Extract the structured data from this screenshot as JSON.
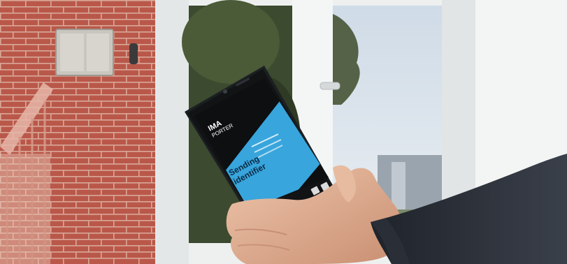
{
  "photo": {
    "phone_screen": {
      "brand_line1": "IMA",
      "brand_line2": "PORTER",
      "message_line1": "Sending",
      "message_line2": "identifier"
    }
  },
  "colors": {
    "brick": "#b9584a",
    "door_frame": "#eef0f0",
    "sky": "#d9e4ef",
    "foliage": "#3c4a2f",
    "phone_body": "#1c1f22",
    "screen_blue": "#38a5dc",
    "skin": "#e2b59a",
    "sleeve": "#2b3038"
  }
}
